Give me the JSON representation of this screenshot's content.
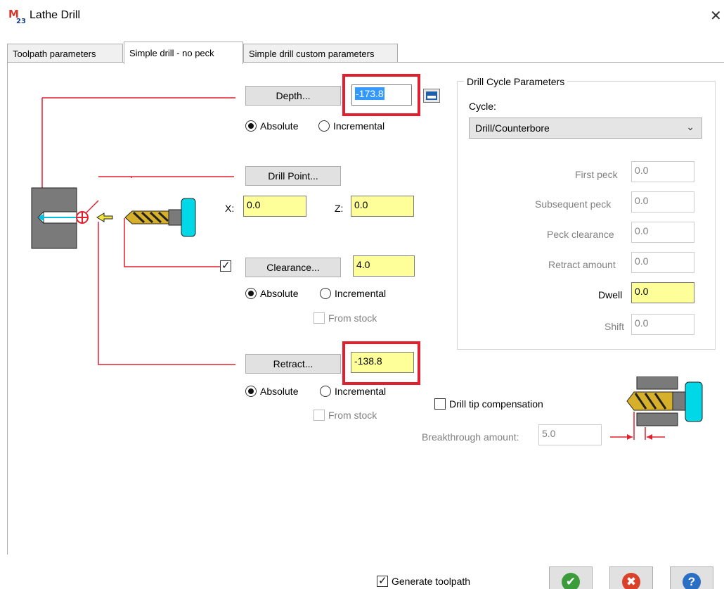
{
  "window": {
    "title": "Lathe Drill",
    "close_icon": "close-icon"
  },
  "tabs": [
    {
      "label": "Toolpath parameters",
      "active": false
    },
    {
      "label": "Simple drill - no peck",
      "active": true
    },
    {
      "label": "Simple drill custom parameters",
      "active": false
    }
  ],
  "depth": {
    "button_label": "Depth...",
    "value": "-173.8",
    "absolute_label": "Absolute",
    "incremental_label": "Incremental",
    "mode": "absolute"
  },
  "drill_point": {
    "button_label": "Drill Point...",
    "x_label": "X:",
    "x_value": "0.0",
    "z_label": "Z:",
    "z_value": "0.0"
  },
  "clearance": {
    "enabled": true,
    "button_label": "Clearance...",
    "value": "4.0",
    "absolute_label": "Absolute",
    "incremental_label": "Incremental",
    "mode": "absolute",
    "from_stock_label": "From stock",
    "from_stock": false
  },
  "retract": {
    "button_label": "Retract...",
    "value": "-138.8",
    "absolute_label": "Absolute",
    "incremental_label": "Incremental",
    "mode": "absolute",
    "from_stock_label": "From stock",
    "from_stock": false
  },
  "drill_cycle": {
    "group_title": "Drill Cycle Parameters",
    "cycle_label": "Cycle:",
    "cycle_value": "Drill/Counterbore",
    "params": [
      {
        "label": "First peck",
        "value": "0.0",
        "enabled": false
      },
      {
        "label": "Subsequent peck",
        "value": "0.0",
        "enabled": false
      },
      {
        "label": "Peck clearance",
        "value": "0.0",
        "enabled": false
      },
      {
        "label": "Retract amount",
        "value": "0.0",
        "enabled": false
      },
      {
        "label": "Dwell",
        "value": "0.0",
        "enabled": true
      },
      {
        "label": "Shift",
        "value": "0.0",
        "enabled": false
      }
    ]
  },
  "tip_compensation": {
    "label": "Drill tip compensation",
    "checked": false,
    "breakthrough_label": "Breakthrough amount:",
    "breakthrough_value": "5.0"
  },
  "footer": {
    "generate_label": "Generate toolpath",
    "generate_checked": true,
    "ok_icon": "checkmark-icon",
    "cancel_icon": "cancel-icon",
    "help_icon": "help-icon"
  },
  "colors": {
    "highlight_field": "#ffff99",
    "red_outline": "#e0202f",
    "ok_green": "#3c9c3c",
    "cancel_red": "#d9412b",
    "help_blue": "#2b6fc4"
  }
}
